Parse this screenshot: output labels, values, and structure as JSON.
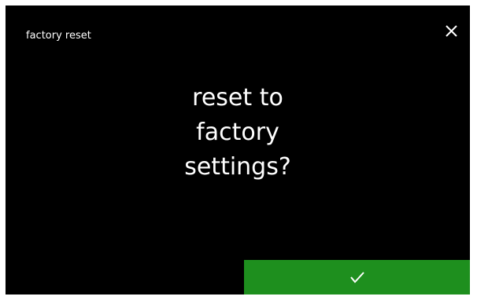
{
  "header": {
    "title": "factory reset",
    "close_icon": "close-icon"
  },
  "dialog": {
    "prompt_lines": [
      "reset to",
      "factory",
      "settings?"
    ]
  },
  "footer": {
    "confirm_icon": "checkmark-icon",
    "confirm_color": "#1e8f1e"
  },
  "colors": {
    "background": "#000000",
    "text": "#ffffff",
    "confirm": "#1e8f1e"
  }
}
